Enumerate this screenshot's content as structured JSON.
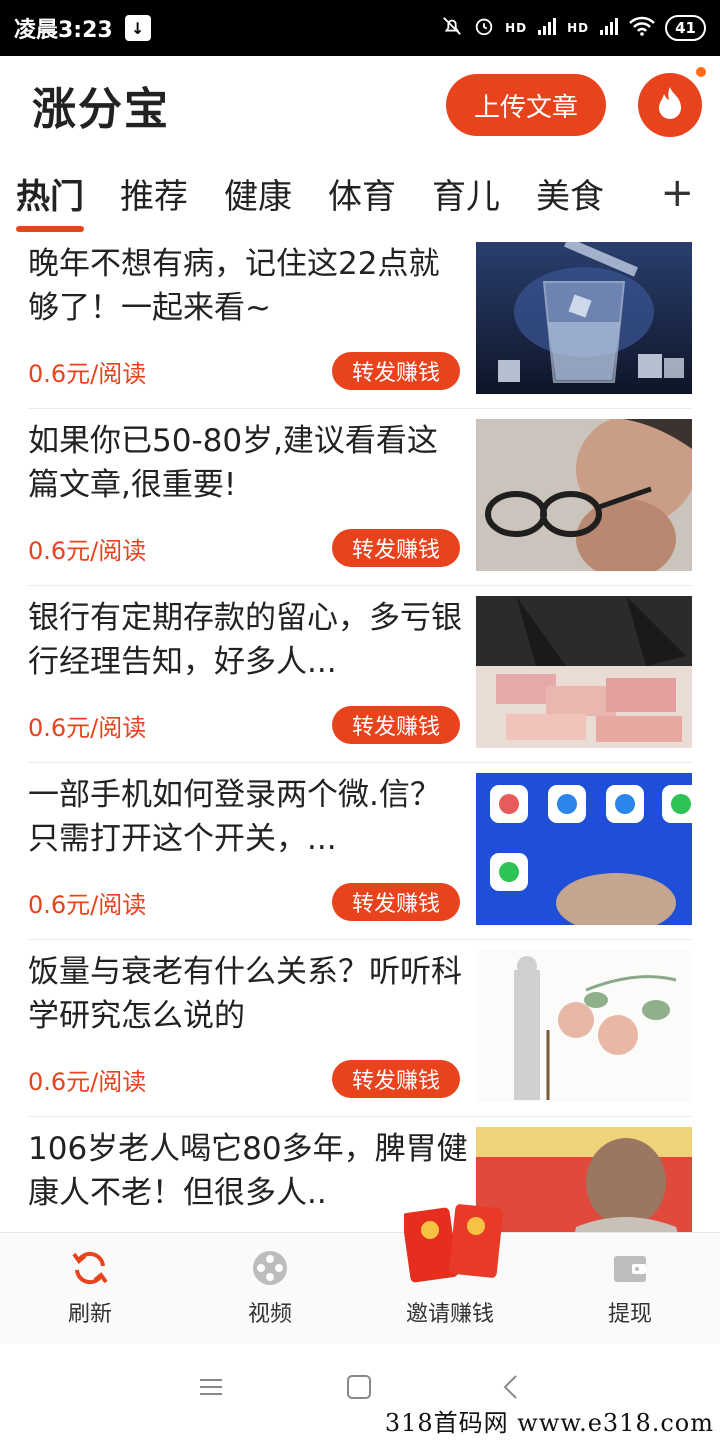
{
  "status_bar": {
    "time": "凌晨3:23",
    "download_icon": "download-icon",
    "mute_icon": "bell-off-icon",
    "alarm_icon": "alarm-icon",
    "signal1": "HD",
    "signal2": "HD",
    "wifi_icon": "wifi-icon",
    "battery": "41"
  },
  "header": {
    "title": "涨分宝",
    "upload_label": "上传文章",
    "fire_icon": "fire-icon"
  },
  "tabs": {
    "items": [
      "热门",
      "推荐",
      "健康",
      "体育",
      "育儿",
      "美食"
    ],
    "active_index": 0,
    "plus_label": "+"
  },
  "feed": {
    "items": [
      {
        "title": "晚年不想有病，记住这22点就够了！一起来看~",
        "price": "0.6元/阅读",
        "share": "转发赚钱",
        "thumb": "glass-of-water"
      },
      {
        "title": "如果你已50-80岁,建议看看这篇文章,很重要!",
        "price": "0.6元/阅读",
        "share": "转发赚钱",
        "thumb": "elderly-woman-glasses"
      },
      {
        "title": "银行有定期存款的留心，多亏银行经理告知，好多人...",
        "price": "0.6元/阅读",
        "share": "转发赚钱",
        "thumb": "bank-money"
      },
      {
        "title": "一部手机如何登录两个微.信？只需打开这个开关，...",
        "price": "0.6元/阅读",
        "share": "转发赚钱",
        "thumb": "phone-apps"
      },
      {
        "title": "饭量与衰老有什么关系？听听科学研究怎么说的",
        "price": "0.6元/阅读",
        "share": "转发赚钱",
        "thumb": "aging-illustration"
      },
      {
        "title": "106岁老人喝它80多年，脾胃健康人不老！但很多人..",
        "price": "",
        "share": "",
        "thumb": "old-woman"
      }
    ]
  },
  "bottom_nav": {
    "refresh": "刷新",
    "video": "视频",
    "invite": "邀请赚钱",
    "withdraw": "提现"
  },
  "system_nav": {
    "menu_icon": "menu-icon",
    "home_icon": "home-icon",
    "back_icon": "back-icon"
  },
  "watermark": "318首码网  www.e318.com",
  "colors": {
    "accent": "#e8431d",
    "text": "#222222"
  }
}
